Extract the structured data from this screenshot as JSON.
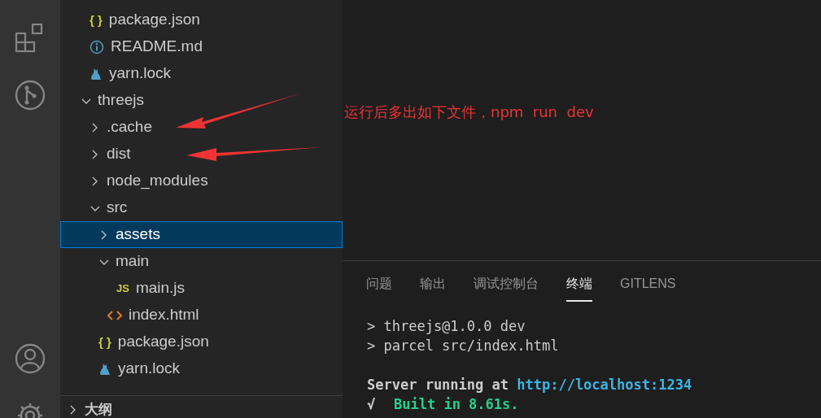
{
  "explorer": {
    "tree": [
      {
        "name": "package.json",
        "kind": "json",
        "badge": "{ }"
      },
      {
        "name": "README.md",
        "kind": "info"
      },
      {
        "name": "yarn.lock",
        "kind": "yarn"
      },
      {
        "name": "threejs",
        "kind": "folder",
        "expanded": true,
        "selected": false,
        "children": [
          {
            "name": ".cache",
            "kind": "folder",
            "expanded": false,
            "selected": false
          },
          {
            "name": "dist",
            "kind": "folder",
            "expanded": false,
            "selected": false
          },
          {
            "name": "node_modules",
            "kind": "folder",
            "expanded": false,
            "selected": false
          },
          {
            "name": "src",
            "kind": "folder",
            "expanded": true,
            "selected": false,
            "children": [
              {
                "name": "assets",
                "kind": "folder",
                "expanded": false,
                "selected": true
              },
              {
                "name": "main",
                "kind": "folder",
                "expanded": true,
                "selected": false,
                "children": [
                  {
                    "name": "main.js",
                    "kind": "js",
                    "badge": "JS"
                  }
                ]
              },
              {
                "name": "index.html",
                "kind": "html"
              }
            ]
          },
          {
            "name": "package.json",
            "kind": "json",
            "badge": "{ }"
          },
          {
            "name": "yarn.lock",
            "kind": "yarn"
          }
        ]
      }
    ]
  },
  "outline": {
    "label": "大纲",
    "expanded": false
  },
  "annotation": {
    "text": "运行后多出如下文件，npm  run  dev"
  },
  "panel": {
    "tabs": [
      {
        "label": "问题",
        "selected": false
      },
      {
        "label": "输出",
        "selected": false
      },
      {
        "label": "调试控制台",
        "selected": false
      },
      {
        "label": "终端",
        "selected": true
      },
      {
        "label": "GITLENS",
        "selected": false
      }
    ],
    "terminal": [
      {
        "kind": "plain",
        "text": "> threejs@1.0.0 dev"
      },
      {
        "kind": "plain",
        "text": "> parcel src/index.html"
      },
      {
        "kind": "blank"
      },
      {
        "kind": "server",
        "text": "Server running at ",
        "link": "http://localhost:1234"
      },
      {
        "kind": "success",
        "mark": "√",
        "text": "Built in 8.61s."
      }
    ]
  }
}
